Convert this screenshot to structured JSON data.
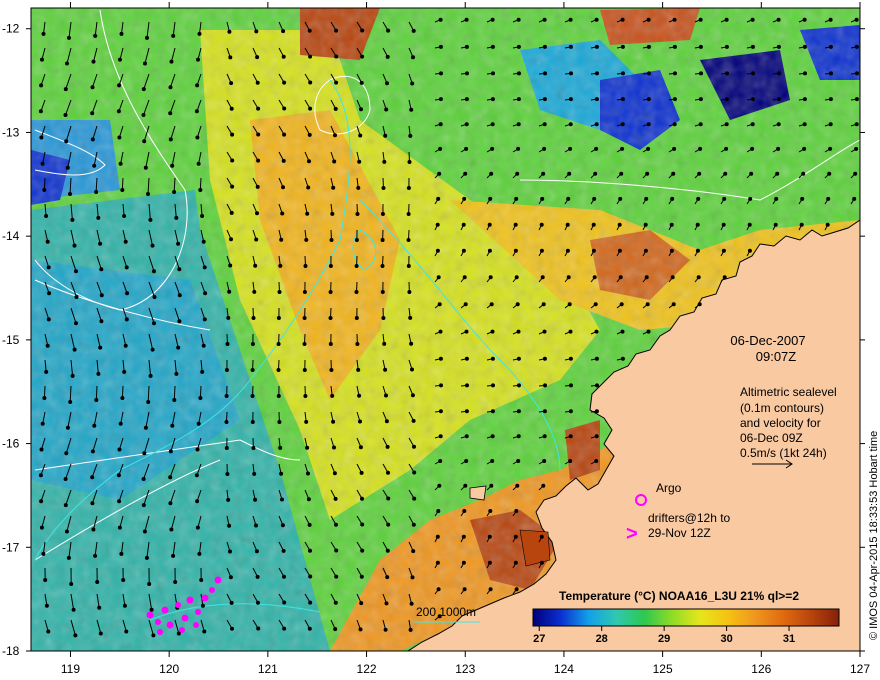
{
  "map": {
    "lon_ticks": [
      "119",
      "120",
      "121",
      "122",
      "123",
      "124",
      "125",
      "126",
      "127"
    ],
    "lat_ticks": [
      "-12",
      "-13",
      "-14",
      "-15",
      "-16",
      "-17",
      "-18"
    ]
  },
  "annotation": {
    "date": "06-Dec-2007",
    "time": "09:07Z",
    "altimetry_lines": [
      "Altimetric sealevel",
      "(0.1m contours)",
      "and velocity for",
      "06-Dec 09Z",
      "0.5m/s (1kt 24h)"
    ]
  },
  "legend": {
    "argo_label": "Argo",
    "drifters_line1": "drifters@12h to",
    "drifters_line2": "29-Nov 12Z",
    "argo_symbol": "o",
    "drifter_symbol": ">"
  },
  "scale": {
    "label": "200  1000m"
  },
  "colorbar": {
    "title": "Temperature (°C) NOAA16_L3U 21% ql>=2",
    "ticks": [
      "27",
      "28",
      "29",
      "30",
      "31"
    ],
    "colors": [
      "#00007a",
      "#0a2fd0",
      "#13a0e8",
      "#30c8b0",
      "#2ec850",
      "#8fdc26",
      "#e6e61c",
      "#f5c214",
      "#f0961e",
      "#e06a10",
      "#b8440e",
      "#862008"
    ]
  },
  "credit": "© IMOS 04-Apr-2015 18:33:53 Hobart time",
  "colors": {
    "land": "#f9c9a2",
    "contour": "#ffffff",
    "bathymetry": "#3ee6e6",
    "drifter": "#ff00ff"
  }
}
